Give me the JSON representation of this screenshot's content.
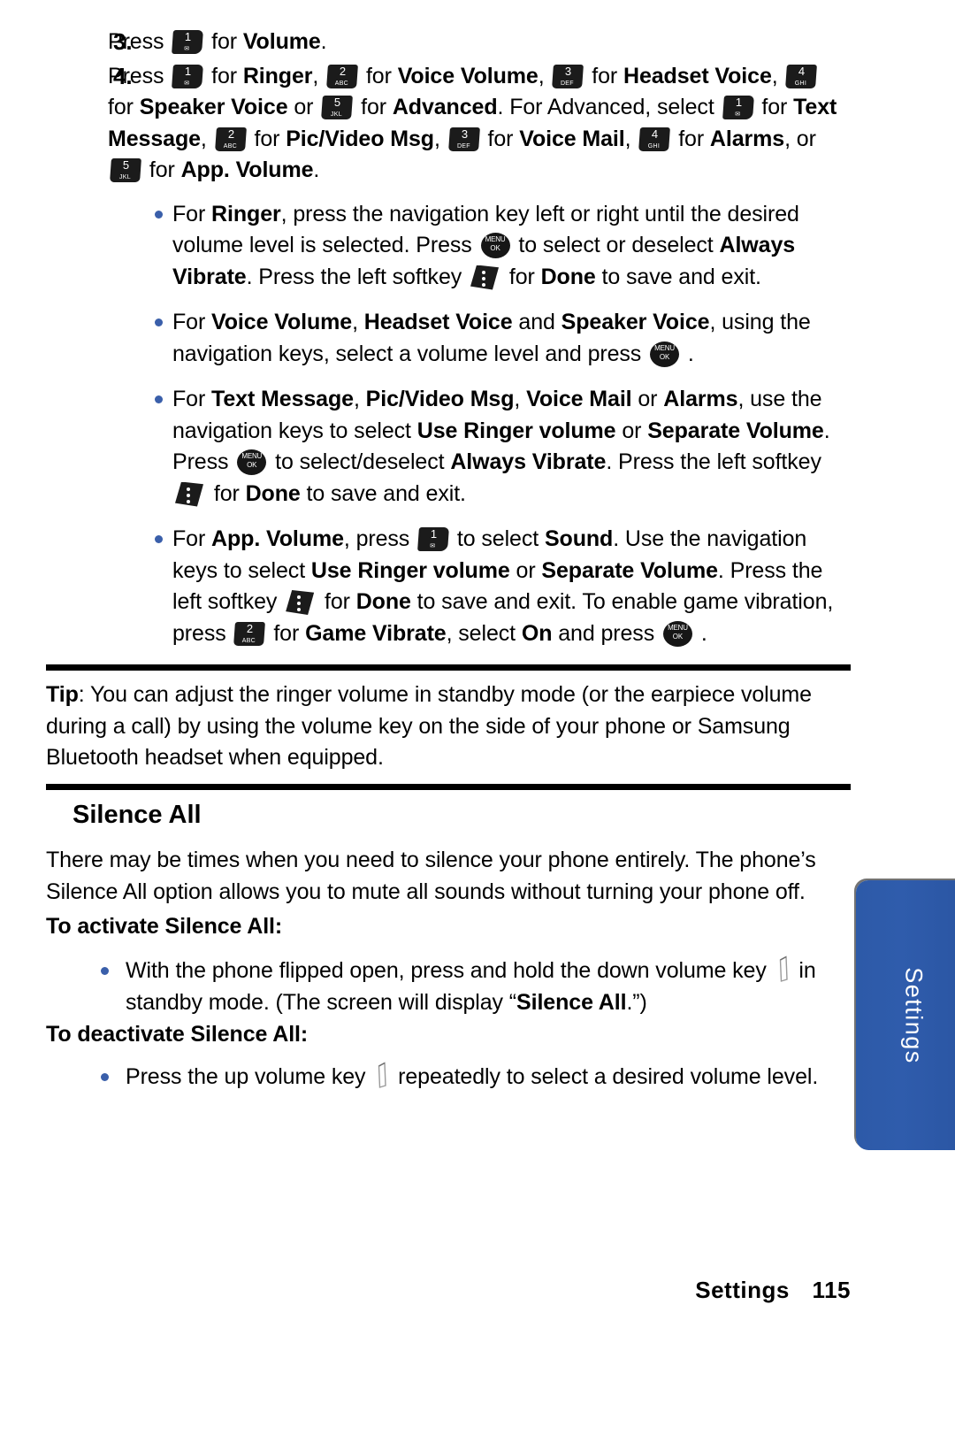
{
  "document": {
    "type": "phone-user-manual-page"
  },
  "steps": [
    {
      "number": "3.",
      "segments": [
        {
          "t": "Press ",
          "s": "normal"
        },
        {
          "t": "key-1",
          "s": "key",
          "num": "1",
          "sub": "✉"
        },
        {
          "t": " for ",
          "s": "normal"
        },
        {
          "t": "Volume",
          "s": "bold"
        },
        {
          "t": ".",
          "s": "normal"
        }
      ]
    },
    {
      "number": "4.",
      "segments": [
        {
          "t": "Press ",
          "s": "normal"
        },
        {
          "t": "key-1",
          "s": "key",
          "num": "1",
          "sub": "✉"
        },
        {
          "t": " for ",
          "s": "normal"
        },
        {
          "t": "Ringer",
          "s": "bold"
        },
        {
          "t": ", ",
          "s": "normal"
        },
        {
          "t": "key-2",
          "s": "key",
          "num": "2",
          "sub": "ABC"
        },
        {
          "t": " for ",
          "s": "normal"
        },
        {
          "t": "Voice Volume",
          "s": "bold"
        },
        {
          "t": ", ",
          "s": "normal"
        },
        {
          "t": "key-3",
          "s": "key",
          "num": "3",
          "sub": "DEF"
        },
        {
          "t": " for ",
          "s": "normal"
        },
        {
          "t": "Headset Voice",
          "s": "bold"
        },
        {
          "t": ", ",
          "s": "normal"
        },
        {
          "t": "key-4",
          "s": "key",
          "num": "4",
          "sub": "GHI"
        },
        {
          "t": " for ",
          "s": "normal"
        },
        {
          "t": "Speaker Voice",
          "s": "bold"
        },
        {
          "t": " or ",
          "s": "normal"
        },
        {
          "t": "key-5",
          "s": "key",
          "num": "5",
          "sub": "JKL"
        },
        {
          "t": " for ",
          "s": "normal"
        },
        {
          "t": "Advanced",
          "s": "bold"
        },
        {
          "t": ". For Advanced, select ",
          "s": "normal"
        },
        {
          "t": "key-1",
          "s": "key",
          "num": "1",
          "sub": "✉"
        },
        {
          "t": " for ",
          "s": "normal"
        },
        {
          "t": "Text Message",
          "s": "bold"
        },
        {
          "t": ", ",
          "s": "normal"
        },
        {
          "t": "key-2",
          "s": "key",
          "num": "2",
          "sub": "ABC"
        },
        {
          "t": " for ",
          "s": "normal"
        },
        {
          "t": "Pic/Video Msg",
          "s": "bold"
        },
        {
          "t": ", ",
          "s": "normal"
        },
        {
          "t": "key-3",
          "s": "key",
          "num": "3",
          "sub": "DEF"
        },
        {
          "t": " for ",
          "s": "normal"
        },
        {
          "t": "Voice Mail",
          "s": "bold"
        },
        {
          "t": ", ",
          "s": "normal"
        },
        {
          "t": "key-4",
          "s": "key",
          "num": "4",
          "sub": "GHI"
        },
        {
          "t": " for ",
          "s": "normal"
        },
        {
          "t": "Alarms",
          "s": "bold"
        },
        {
          "t": ", or ",
          "s": "normal"
        },
        {
          "t": "key-5",
          "s": "key",
          "num": "5",
          "sub": "JKL"
        },
        {
          "t": " for ",
          "s": "normal"
        },
        {
          "t": "App. Volume",
          "s": "bold"
        },
        {
          "t": ".",
          "s": "normal"
        }
      ]
    }
  ],
  "bullets": [
    {
      "segments": [
        {
          "t": "For ",
          "s": "normal"
        },
        {
          "t": "Ringer",
          "s": "bold"
        },
        {
          "t": ", press the navigation key left or right until the desired volume level is selected. Press ",
          "s": "normal"
        },
        {
          "t": "menu-ok-key",
          "s": "menukey",
          "line1": "MENU",
          "line2": "OK"
        },
        {
          "t": " to select or deselect ",
          "s": "normal"
        },
        {
          "t": "Always Vibrate",
          "s": "bold"
        },
        {
          "t": ". Press the left softkey ",
          "s": "normal"
        },
        {
          "t": "soft-key",
          "s": "softkey"
        },
        {
          "t": " for ",
          "s": "normal"
        },
        {
          "t": "Done",
          "s": "bold"
        },
        {
          "t": " to save and exit.",
          "s": "normal"
        }
      ]
    },
    {
      "segments": [
        {
          "t": "For ",
          "s": "normal"
        },
        {
          "t": "Voice Volume",
          "s": "bold"
        },
        {
          "t": ", ",
          "s": "normal"
        },
        {
          "t": "Headset Voice",
          "s": "bold"
        },
        {
          "t": " and ",
          "s": "normal"
        },
        {
          "t": "Speaker Voice",
          "s": "bold"
        },
        {
          "t": ", using the navigation keys, select a volume level and press ",
          "s": "normal"
        },
        {
          "t": "menu-ok-key",
          "s": "menukey",
          "line1": "MENU",
          "line2": "OK"
        },
        {
          "t": " .",
          "s": "normal"
        }
      ]
    },
    {
      "segments": [
        {
          "t": "For ",
          "s": "normal"
        },
        {
          "t": "Text Message",
          "s": "bold"
        },
        {
          "t": ", ",
          "s": "normal"
        },
        {
          "t": "Pic/Video Msg",
          "s": "bold"
        },
        {
          "t": ", ",
          "s": "normal"
        },
        {
          "t": "Voice Mail",
          "s": "bold"
        },
        {
          "t": " or ",
          "s": "normal"
        },
        {
          "t": "Alarms",
          "s": "bold"
        },
        {
          "t": ", use the navigation keys to select ",
          "s": "normal"
        },
        {
          "t": "Use Ringer volume",
          "s": "bold"
        },
        {
          "t": " or ",
          "s": "normal"
        },
        {
          "t": "Separate Volume",
          "s": "bold"
        },
        {
          "t": ". Press ",
          "s": "normal"
        },
        {
          "t": "menu-ok-key",
          "s": "menukey",
          "line1": "MENU",
          "line2": "OK"
        },
        {
          "t": " to select/deselect ",
          "s": "normal"
        },
        {
          "t": "Always Vibrate",
          "s": "bold"
        },
        {
          "t": ". Press the left softkey ",
          "s": "normal"
        },
        {
          "t": "soft-key",
          "s": "softkey"
        },
        {
          "t": " for ",
          "s": "normal"
        },
        {
          "t": "Done",
          "s": "bold"
        },
        {
          "t": " to save and exit.",
          "s": "normal"
        }
      ]
    },
    {
      "segments": [
        {
          "t": "For ",
          "s": "normal"
        },
        {
          "t": "App. Volume",
          "s": "bold"
        },
        {
          "t": ", press ",
          "s": "normal"
        },
        {
          "t": "key-1",
          "s": "key",
          "num": "1",
          "sub": "✉"
        },
        {
          "t": " to select ",
          "s": "normal"
        },
        {
          "t": "Sound",
          "s": "bold"
        },
        {
          "t": ". Use the navigation keys to select ",
          "s": "normal"
        },
        {
          "t": "Use Ringer volume",
          "s": "bold"
        },
        {
          "t": " or ",
          "s": "normal"
        },
        {
          "t": "Separate Volume",
          "s": "bold"
        },
        {
          "t": ". Press the left softkey ",
          "s": "normal"
        },
        {
          "t": "soft-key",
          "s": "softkey"
        },
        {
          "t": " for ",
          "s": "normal"
        },
        {
          "t": "Done",
          "s": "bold"
        },
        {
          "t": " to save and exit. To enable game vibration, press ",
          "s": "normal"
        },
        {
          "t": "key-2",
          "s": "key",
          "num": "2",
          "sub": "ABC"
        },
        {
          "t": " for ",
          "s": "normal"
        },
        {
          "t": "Game Vibrate",
          "s": "bold"
        },
        {
          "t": ", select ",
          "s": "normal"
        },
        {
          "t": "On",
          "s": "bold"
        },
        {
          "t": " and press ",
          "s": "normal"
        },
        {
          "t": "menu-ok-key",
          "s": "menukey",
          "line1": "MENU",
          "line2": "OK"
        },
        {
          "t": " .",
          "s": "normal"
        }
      ]
    }
  ],
  "tip": {
    "segments": [
      {
        "t": "Tip",
        "s": "bold"
      },
      {
        "t": ": You can adjust the ringer volume in standby mode (or the earpiece volume during a call) by using the volume key on the side of your phone or Samsung Bluetooth headset when equipped.",
        "s": "normal"
      }
    ]
  },
  "silence_all": {
    "heading": "Silence All",
    "intro": "There may be times when you need to silence your phone entirely. The phone’s Silence All option allows you to mute all sounds without turning your phone off.",
    "activate_heading": "To activate Silence All:",
    "activate_bullet": [
      {
        "t": "With the phone flipped open, press and hold the down volume key ",
        "s": "normal"
      },
      {
        "t": "volume-side-key",
        "s": "volkey"
      },
      {
        "t": " in standby mode. (The screen will display “",
        "s": "normal"
      },
      {
        "t": "Silence All",
        "s": "bold"
      },
      {
        "t": ".”)",
        "s": "normal"
      }
    ],
    "deactivate_heading": "To deactivate Silence All:",
    "deactivate_bullet": [
      {
        "t": "Press the up volume key ",
        "s": "normal"
      },
      {
        "t": "volume-side-key",
        "s": "volkey"
      },
      {
        "t": " repeatedly to select a desired volume level.",
        "s": "normal"
      }
    ]
  },
  "side_tab": {
    "label": "Settings",
    "color": "#2d5aa8"
  },
  "footer": {
    "section": "Settings",
    "page_number": "115"
  },
  "colors": {
    "bullet": "#3a5faa",
    "tab_blue": "#2d5aa8",
    "key_black": "#1b1b1b"
  }
}
